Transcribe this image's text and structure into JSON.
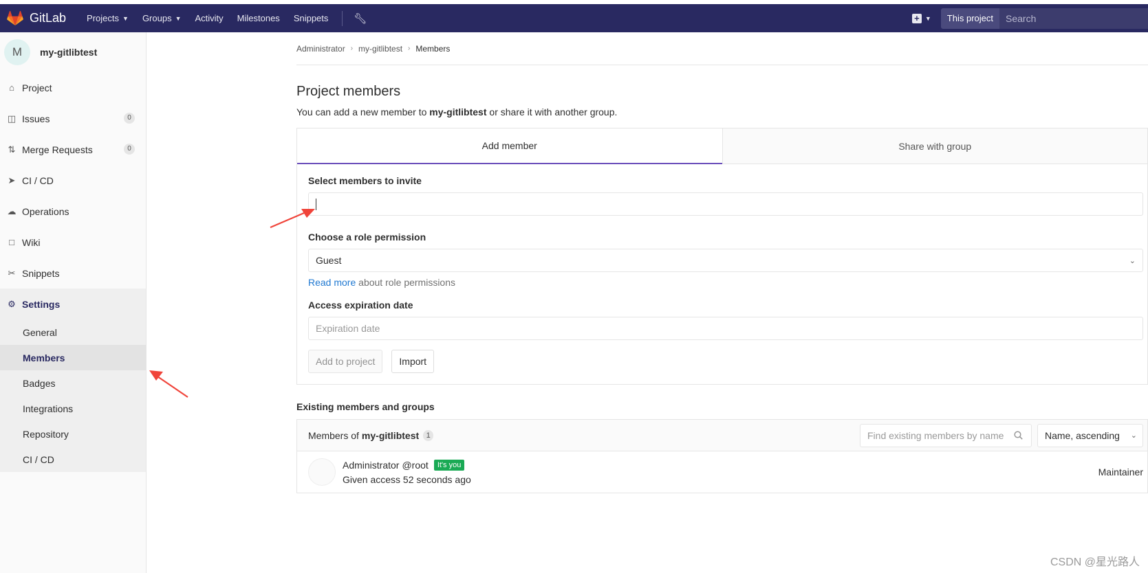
{
  "navbar": {
    "logo_text": "GitLab",
    "items": [
      {
        "label": "Projects",
        "dropdown": true
      },
      {
        "label": "Groups",
        "dropdown": true
      },
      {
        "label": "Activity",
        "dropdown": false
      },
      {
        "label": "Milestones",
        "dropdown": false
      },
      {
        "label": "Snippets",
        "dropdown": false
      }
    ],
    "admin_icon": "wrench-icon",
    "scope_label": "This project",
    "search_placeholder": "Search",
    "brand_color": "#292961"
  },
  "sidebar": {
    "avatar_letter": "M",
    "project_name": "my-gitlibtest",
    "items": [
      {
        "label": "Project",
        "icon": "home-icon"
      },
      {
        "label": "Issues",
        "icon": "issues-icon",
        "count": "0"
      },
      {
        "label": "Merge Requests",
        "icon": "merge-request-icon",
        "count": "0"
      },
      {
        "label": "CI / CD",
        "icon": "rocket-icon"
      },
      {
        "label": "Operations",
        "icon": "cloud-gear-icon"
      },
      {
        "label": "Wiki",
        "icon": "book-icon"
      },
      {
        "label": "Snippets",
        "icon": "scissors-icon"
      }
    ],
    "settings_label": "Settings",
    "settings_sub": [
      "General",
      "Members",
      "Badges",
      "Integrations",
      "Repository",
      "CI / CD"
    ],
    "active_sub": "Members"
  },
  "breadcrumb": [
    "Administrator",
    "my-gitlibtest",
    "Members"
  ],
  "page": {
    "title": "Project members",
    "desc_prefix": "You can add a new member to",
    "desc_project": "my-gitlibtest",
    "desc_suffix": "or share it with another group."
  },
  "tabs": {
    "add_member": "Add member",
    "share_group": "Share with group"
  },
  "form": {
    "invite_label": "Select members to invite",
    "invite_value": "",
    "role_label": "Choose a role permission",
    "role_value": "Guest",
    "read_more": "Read more",
    "read_more_suffix": "about role permissions",
    "expiration_label": "Access expiration date",
    "expiration_placeholder": "Expiration date",
    "add_button": "Add to project",
    "import_button": "Import"
  },
  "members": {
    "section_title": "Existing members and groups",
    "header_prefix": "Members of",
    "header_project": "my-gitlibtest",
    "count": "1",
    "find_placeholder": "Find existing members by name",
    "sort_value": "Name, ascending",
    "rows": [
      {
        "name": "Administrator",
        "handle": "@root",
        "badge": "It's you",
        "given_access": "Given access 52 seconds ago",
        "role": "Maintainer"
      }
    ]
  },
  "watermark": "CSDN @星光路人",
  "annotation_color": "#f0443a"
}
